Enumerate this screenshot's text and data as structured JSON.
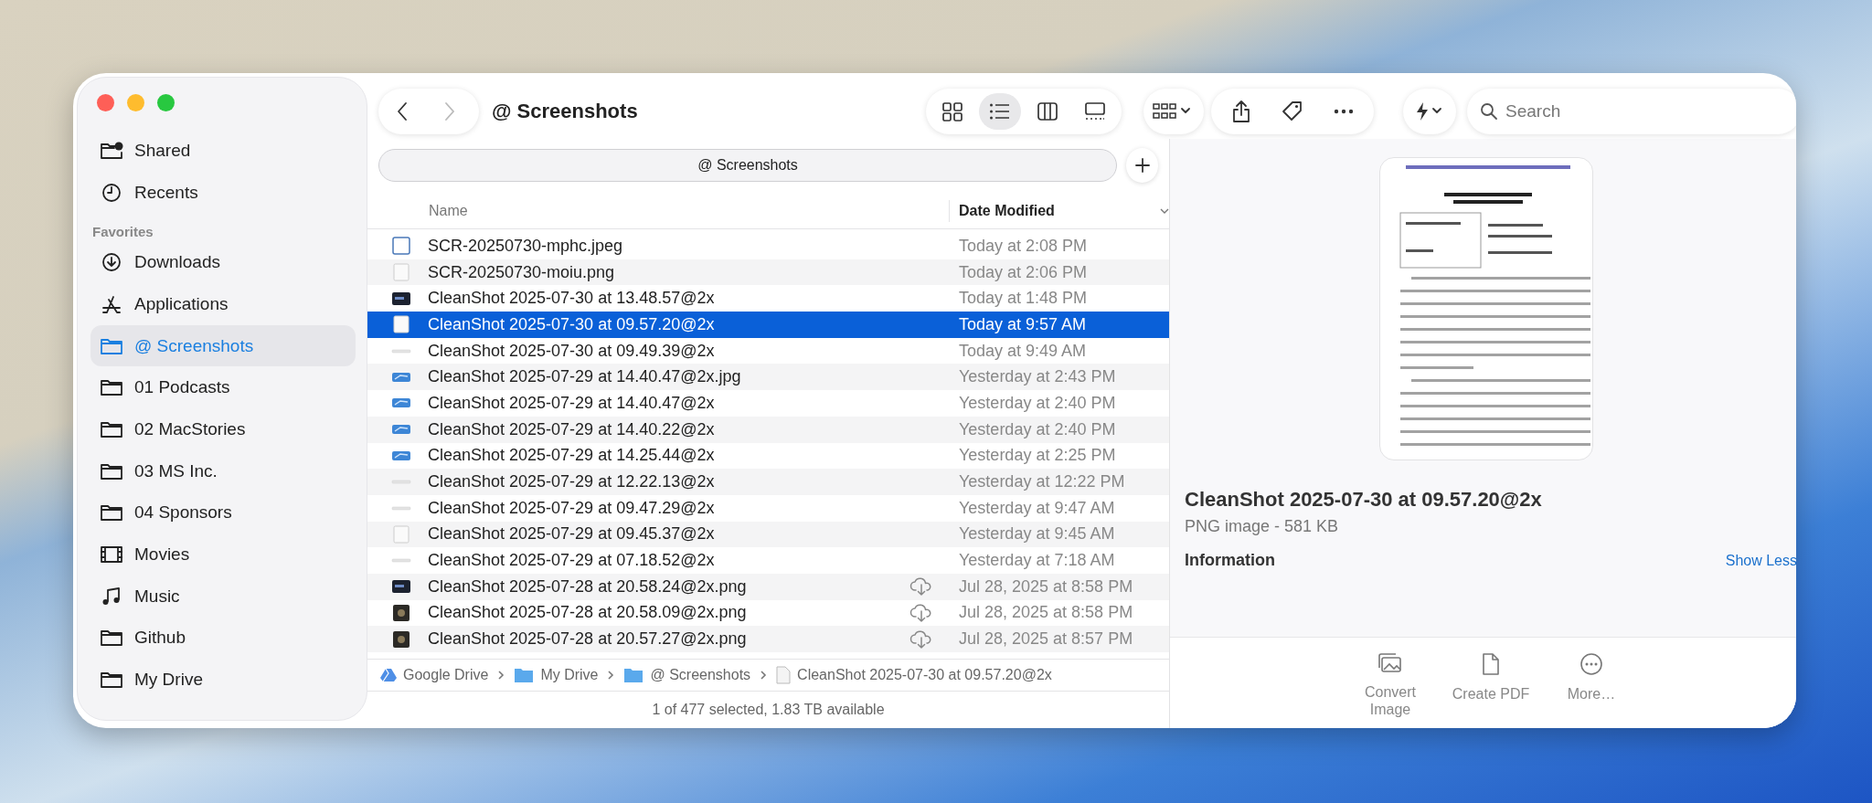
{
  "sidebar": {
    "items": [
      {
        "label": "Shared",
        "kind": "shared",
        "selected": false
      },
      {
        "label": "Recents",
        "kind": "recents",
        "selected": false
      }
    ],
    "sections": [
      {
        "title": "Favorites",
        "items": [
          {
            "label": "Downloads",
            "kind": "downloads",
            "selected": false
          },
          {
            "label": "Applications",
            "kind": "applications",
            "selected": false
          },
          {
            "label": "@ Screenshots",
            "kind": "folder",
            "selected": true
          },
          {
            "label": "01 Podcasts",
            "kind": "folder",
            "selected": false
          },
          {
            "label": "02 MacStories",
            "kind": "folder",
            "selected": false
          },
          {
            "label": "03 MS Inc.",
            "kind": "folder",
            "selected": false
          },
          {
            "label": "04 Sponsors",
            "kind": "folder",
            "selected": false
          },
          {
            "label": "Movies",
            "kind": "movies",
            "selected": false
          },
          {
            "label": "Music",
            "kind": "music",
            "selected": false
          },
          {
            "label": "Github",
            "kind": "folder",
            "selected": false
          },
          {
            "label": "My Drive",
            "kind": "folder",
            "selected": false
          }
        ]
      }
    ]
  },
  "toolbar": {
    "title": "@ Screenshots",
    "view_modes": [
      {
        "kind": "icons",
        "selected": false
      },
      {
        "kind": "list",
        "selected": true
      },
      {
        "kind": "columns",
        "selected": false
      },
      {
        "kind": "gallery",
        "selected": false
      }
    ],
    "search": {
      "placeholder": "Search"
    }
  },
  "tab_bar": {
    "tabs": [
      {
        "label": "@ Screenshots"
      }
    ]
  },
  "table": {
    "columns": [
      {
        "label": "Name",
        "sorted": false
      },
      {
        "label": "Date Modified",
        "sorted": true
      }
    ],
    "rows": [
      {
        "name": "SCR-20250730-mphc.jpeg",
        "date": "Today at 2:08 PM",
        "kind": "frame",
        "cloud": false,
        "selected": false
      },
      {
        "name": "SCR-20250730-moiu.png",
        "date": "Today at 2:06 PM",
        "kind": "page",
        "cloud": false,
        "selected": false
      },
      {
        "name": "CleanShot 2025-07-30 at 13.48.57@2x",
        "date": "Today at 1:48 PM",
        "kind": "dark",
        "cloud": false,
        "selected": false
      },
      {
        "name": "CleanShot 2025-07-30 at 09.57.20@2x",
        "date": "Today at 9:57 AM",
        "kind": "page",
        "cloud": false,
        "selected": true
      },
      {
        "name": "CleanShot 2025-07-30 at 09.49.39@2x",
        "date": "Today at 9:49 AM",
        "kind": "line",
        "cloud": false,
        "selected": false
      },
      {
        "name": "CleanShot 2025-07-29 at 14.40.47@2x.jpg",
        "date": "Yesterday at 2:43 PM",
        "kind": "blue",
        "cloud": false,
        "selected": false
      },
      {
        "name": "CleanShot 2025-07-29 at 14.40.47@2x",
        "date": "Yesterday at 2:40 PM",
        "kind": "blue",
        "cloud": false,
        "selected": false
      },
      {
        "name": "CleanShot 2025-07-29 at 14.40.22@2x",
        "date": "Yesterday at 2:40 PM",
        "kind": "blue",
        "cloud": false,
        "selected": false
      },
      {
        "name": "CleanShot 2025-07-29 at 14.25.44@2x",
        "date": "Yesterday at 2:25 PM",
        "kind": "blue",
        "cloud": false,
        "selected": false
      },
      {
        "name": "CleanShot 2025-07-29 at 12.22.13@2x",
        "date": "Yesterday at 12:22 PM",
        "kind": "line",
        "cloud": false,
        "selected": false
      },
      {
        "name": "CleanShot 2025-07-29 at 09.47.29@2x",
        "date": "Yesterday at 9:47 AM",
        "kind": "line",
        "cloud": false,
        "selected": false
      },
      {
        "name": "CleanShot 2025-07-29 at 09.45.37@2x",
        "date": "Yesterday at 9:45 AM",
        "kind": "page",
        "cloud": false,
        "selected": false
      },
      {
        "name": "CleanShot 2025-07-29 at 07.18.52@2x",
        "date": "Yesterday at 7:18 AM",
        "kind": "line",
        "cloud": false,
        "selected": false
      },
      {
        "name": "CleanShot 2025-07-28 at 20.58.24@2x.png",
        "date": "Jul 28, 2025 at 8:58 PM",
        "kind": "dark",
        "cloud": true,
        "selected": false
      },
      {
        "name": "CleanShot 2025-07-28 at 20.58.09@2x.png",
        "date": "Jul 28, 2025 at 8:58 PM",
        "kind": "photo",
        "cloud": true,
        "selected": false
      },
      {
        "name": "CleanShot 2025-07-28 at 20.57.27@2x.png",
        "date": "Jul 28, 2025 at 8:57 PM",
        "kind": "photo",
        "cloud": true,
        "selected": false
      }
    ]
  },
  "path_bar": [
    {
      "label": "Google Drive",
      "kind": "drive"
    },
    {
      "label": "My Drive",
      "kind": "folder"
    },
    {
      "label": "@ Screenshots",
      "kind": "folder"
    },
    {
      "label": "CleanShot 2025-07-30 at 09.57.20@2x",
      "kind": "file"
    }
  ],
  "status_bar": "1 of 477 selected, 1.83 TB available",
  "preview": {
    "title": "CleanShot 2025-07-30 at 09.57.20@2x",
    "subtitle": "PNG image - 581 KB",
    "section_title": "Information",
    "toggle": "Show Less",
    "actions": [
      {
        "label": "Convert Image",
        "kind": "convert"
      },
      {
        "label": "Create PDF",
        "kind": "pdf"
      },
      {
        "label": "More…",
        "kind": "more"
      }
    ]
  }
}
